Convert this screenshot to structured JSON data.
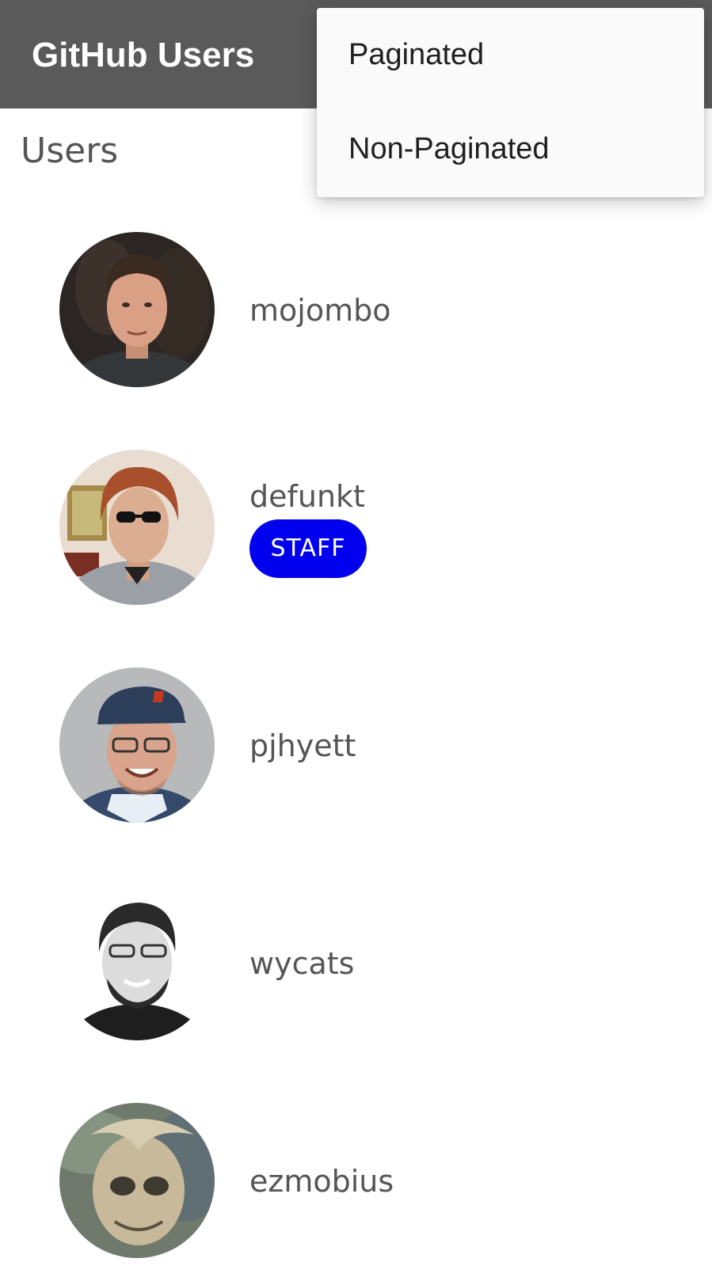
{
  "app_bar": {
    "title": "GitHub Users",
    "background": "#5a5a5a"
  },
  "section": {
    "title": "Users"
  },
  "users": [
    {
      "login": "mojombo",
      "badge": null,
      "avatar": "user-photo-mojombo"
    },
    {
      "login": "defunkt",
      "badge": "STAFF",
      "avatar": "user-photo-defunkt"
    },
    {
      "login": "pjhyett",
      "badge": null,
      "avatar": "user-photo-pjhyett"
    },
    {
      "login": "wycats",
      "badge": null,
      "avatar": "user-photo-wycats"
    },
    {
      "login": "ezmobius",
      "badge": null,
      "avatar": "user-photo-ezmobius"
    }
  ],
  "badge_color": "#0000ee",
  "menu": {
    "items": [
      {
        "label": "Paginated"
      },
      {
        "label": "Non-Paginated"
      }
    ]
  }
}
